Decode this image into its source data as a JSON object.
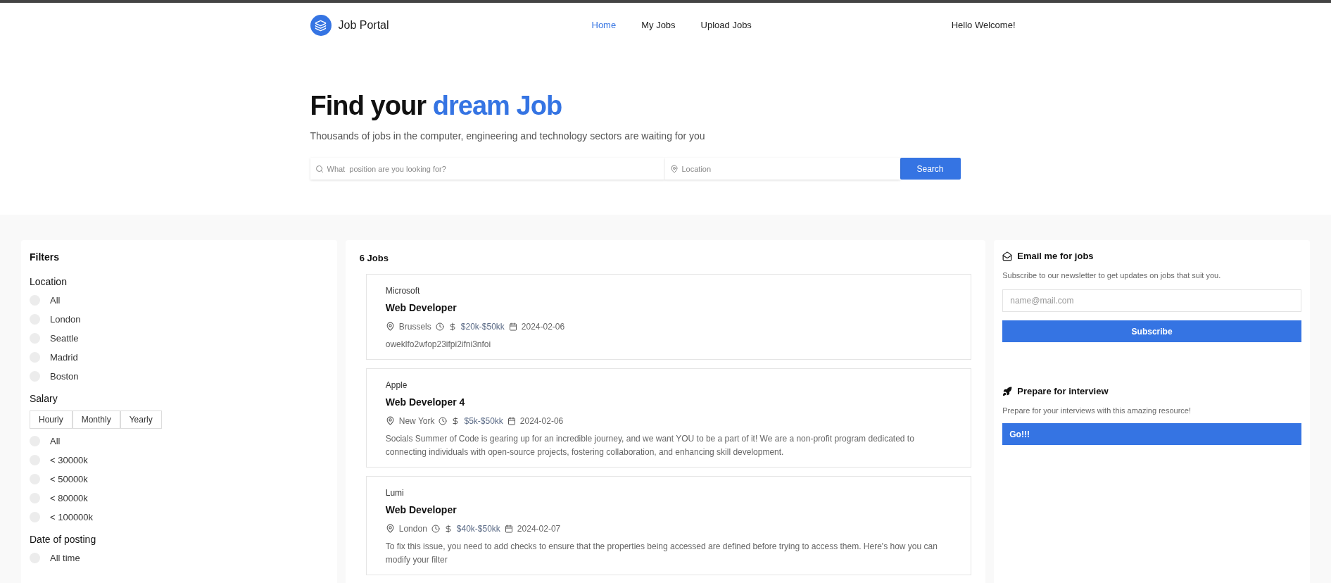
{
  "brand": {
    "name": "Job Portal"
  },
  "nav": [
    {
      "label": "Home",
      "selected": true
    },
    {
      "label": "My Jobs",
      "selected": false
    },
    {
      "label": "Upload Jobs",
      "selected": false
    }
  ],
  "greeting": "Hello Welcome!",
  "hero": {
    "title_plain": "Find your",
    "title_accent": "dream Job",
    "subtitle": "Thousands of jobs in the computer, engineering and technology sectors are waiting for you"
  },
  "search": {
    "query_placeholder": "What  position are you looking for?",
    "location_placeholder": "Location",
    "button": "Search"
  },
  "filters": {
    "title": "Filters",
    "location": {
      "title": "Location",
      "options": [
        {
          "label": "All",
          "selected": false
        },
        {
          "label": "London",
          "selected": false
        },
        {
          "label": "Seattle",
          "selected": false
        },
        {
          "label": "Madrid",
          "selected": false
        },
        {
          "label": "Boston",
          "selected": false
        }
      ]
    },
    "salary": {
      "title": "Salary",
      "periods": [
        {
          "label": "Hourly",
          "selected": false
        },
        {
          "label": "Monthly",
          "selected": false
        },
        {
          "label": "Yearly",
          "selected": false
        }
      ],
      "options": [
        {
          "label": "All",
          "selected": false
        },
        {
          "label": "< 30000k",
          "selected": false
        },
        {
          "label": "< 50000k",
          "selected": false
        },
        {
          "label": "< 80000k",
          "selected": false
        },
        {
          "label": "< 100000k",
          "selected": false
        }
      ]
    },
    "date": {
      "title": "Date of posting",
      "options": [
        {
          "label": "All time",
          "selected": false
        }
      ]
    }
  },
  "jobs": {
    "count": "6 Jobs",
    "items": [
      {
        "company": "Microsoft",
        "title": "Web Developer",
        "location": "Brussels",
        "salary": "$20k-$50kk",
        "date": "2024-02-06",
        "description": "oweklfo2wfop23ifpi2ifni3nfoi"
      },
      {
        "company": "Apple",
        "title": "Web Developer 4",
        "location": "New York",
        "salary": "$5k-$50kk",
        "date": "2024-02-06",
        "description": "Socials Summer of Code is gearing up for an incredible journey, and we want YOU to be a part of it! We are a non-profit program dedicated to connecting individuals with open-source projects, fostering collaboration, and enhancing skill development."
      },
      {
        "company": "Lumi",
        "title": "Web Developer",
        "location": "London",
        "salary": "$40k-$50kk",
        "date": "2024-02-07",
        "description": "To fix this issue, you need to add checks to ensure that the properties being accessed are defined before trying to access them. Here's how you can modify your filter"
      }
    ]
  },
  "newsletter": {
    "title": "Email me for jobs",
    "text": "Subscribe to our newsletter to get updates on jobs that suit you.",
    "placeholder": "name@mail.com",
    "button": "Subscribe"
  },
  "interview": {
    "title": "Prepare for interview",
    "text": "Prepare for your interviews with this amazing resource!",
    "button": "Go!!!"
  }
}
